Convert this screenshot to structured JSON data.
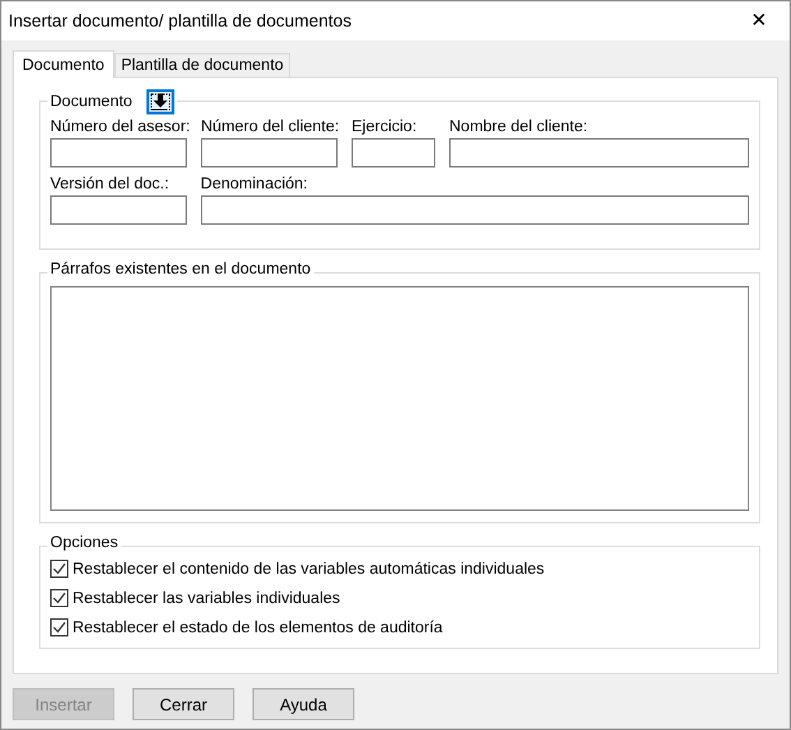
{
  "window": {
    "title": "Insertar documento/ plantilla de documentos",
    "close": "✕"
  },
  "tabs": [
    {
      "label": "Documento",
      "selected": true
    },
    {
      "label": "Plantilla de documento",
      "selected": false
    }
  ],
  "document_group": {
    "title": "Documento",
    "fields": [
      {
        "label": "Número del asesor:"
      },
      {
        "label": "Número del cliente:"
      },
      {
        "label": "Ejercicio:"
      },
      {
        "label": "Nombre del cliente:"
      },
      {
        "label": "Versión del doc.:"
      },
      {
        "label": "Denominación:"
      }
    ]
  },
  "paragraphs_group": {
    "title": "Párrafos existentes en el documento"
  },
  "options_group": {
    "title": "Opciones",
    "options": [
      {
        "label": "Restablecer el contenido de las variables automáticas individuales",
        "checked": true
      },
      {
        "label": "Restablecer las variables individuales",
        "checked": true
      },
      {
        "label": "Restablecer el estado de los elementos de auditoría",
        "checked": true
      }
    ]
  },
  "buttons": [
    {
      "label": "Insertar",
      "disabled": true
    },
    {
      "label": "Cerrar",
      "disabled": false
    },
    {
      "label": "Ayuda",
      "disabled": false
    }
  ]
}
